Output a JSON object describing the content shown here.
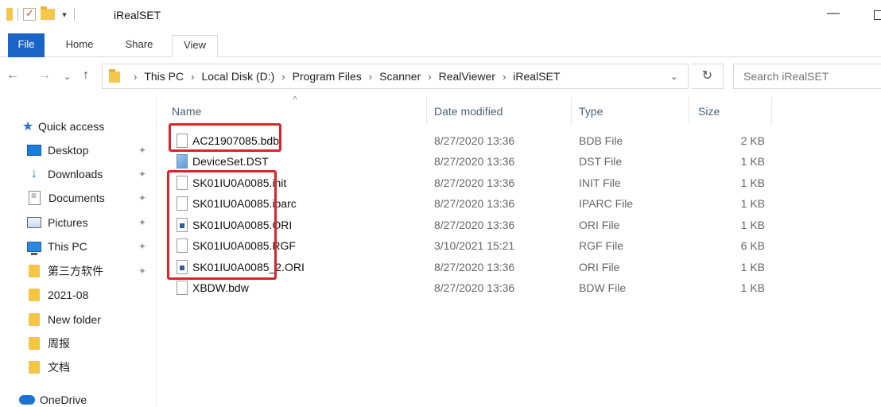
{
  "window": {
    "title": "iRealSET",
    "minimize_glyph": "—"
  },
  "quick_access_toolbar": {
    "dropdown_glyph": "▾"
  },
  "ribbon": {
    "tabs": [
      {
        "label": "File",
        "active": true
      },
      {
        "label": "Home"
      },
      {
        "label": "Share"
      },
      {
        "label": "View"
      }
    ]
  },
  "navigation": {
    "back_icon": "←",
    "forward_icon": "→",
    "recent_icon": "⌄",
    "up_icon": "↑",
    "breadcrumbs": [
      "This PC",
      "Local Disk (D:)",
      "Program Files",
      "Scanner",
      "RealViewer",
      "iRealSET"
    ],
    "separator": "›",
    "dropdown_icon": "⌄",
    "refresh_icon": "↻",
    "search_placeholder": "Search iRealSET"
  },
  "sidebar": {
    "pin_glyph": "✦",
    "items": [
      {
        "label": "Quick access",
        "icon": "star-icon"
      },
      {
        "label": "Desktop",
        "icon": "desktop-icon",
        "pinned": true
      },
      {
        "label": "Downloads",
        "icon": "download-icon",
        "pinned": true
      },
      {
        "label": "Documents",
        "icon": "documents-icon",
        "pinned": true
      },
      {
        "label": "Pictures",
        "icon": "pictures-icon",
        "pinned": true
      },
      {
        "label": "This PC",
        "icon": "this-pc-icon",
        "pinned": true
      },
      {
        "label": "第三方软件",
        "icon": "folder-icon",
        "pinned": true
      },
      {
        "label": "2021-08",
        "icon": "folder-icon"
      },
      {
        "label": "New folder",
        "icon": "folder-icon"
      },
      {
        "label": "周报",
        "icon": "folder-icon"
      },
      {
        "label": "文档",
        "icon": "folder-icon"
      },
      {
        "label": "OneDrive",
        "icon": "onedrive-icon"
      }
    ]
  },
  "file_list": {
    "columns": {
      "name": "Name",
      "date": "Date modified",
      "type": "Type",
      "size": "Size"
    },
    "sort_glyph": "^",
    "files": [
      {
        "name": "AC21907085.bdb",
        "date": "8/27/2020 13:36",
        "type": "BDB File",
        "size": "2 KB",
        "icon": "file-icon"
      },
      {
        "name": "DeviceSet.DST",
        "date": "8/27/2020 13:36",
        "type": "DST File",
        "size": "1 KB",
        "icon": "dst-file-icon"
      },
      {
        "name": "SK01IU0A0085.init",
        "date": "8/27/2020 13:36",
        "type": "INIT File",
        "size": "1 KB",
        "icon": "file-icon"
      },
      {
        "name": "SK01IU0A0085.iparc",
        "date": "8/27/2020 13:36",
        "type": "IPARC File",
        "size": "1 KB",
        "icon": "file-icon"
      },
      {
        "name": "SK01IU0A0085.ORI",
        "date": "8/27/2020 13:36",
        "type": "ORI File",
        "size": "1 KB",
        "icon": "ori-file-icon"
      },
      {
        "name": "SK01IU0A0085.RGF",
        "date": "3/10/2021 15:21",
        "type": "RGF File",
        "size": "6 KB",
        "icon": "file-icon"
      },
      {
        "name": "SK01IU0A0085_2.ORI",
        "date": "8/27/2020 13:36",
        "type": "ORI File",
        "size": "1 KB",
        "icon": "ori-file-icon"
      },
      {
        "name": "XBDW.bdw",
        "date": "8/27/2020 13:36",
        "type": "BDW File",
        "size": "1 KB",
        "icon": "file-icon"
      }
    ]
  },
  "highlight_color": "#d9252a",
  "accent_color": "#1a64c8"
}
